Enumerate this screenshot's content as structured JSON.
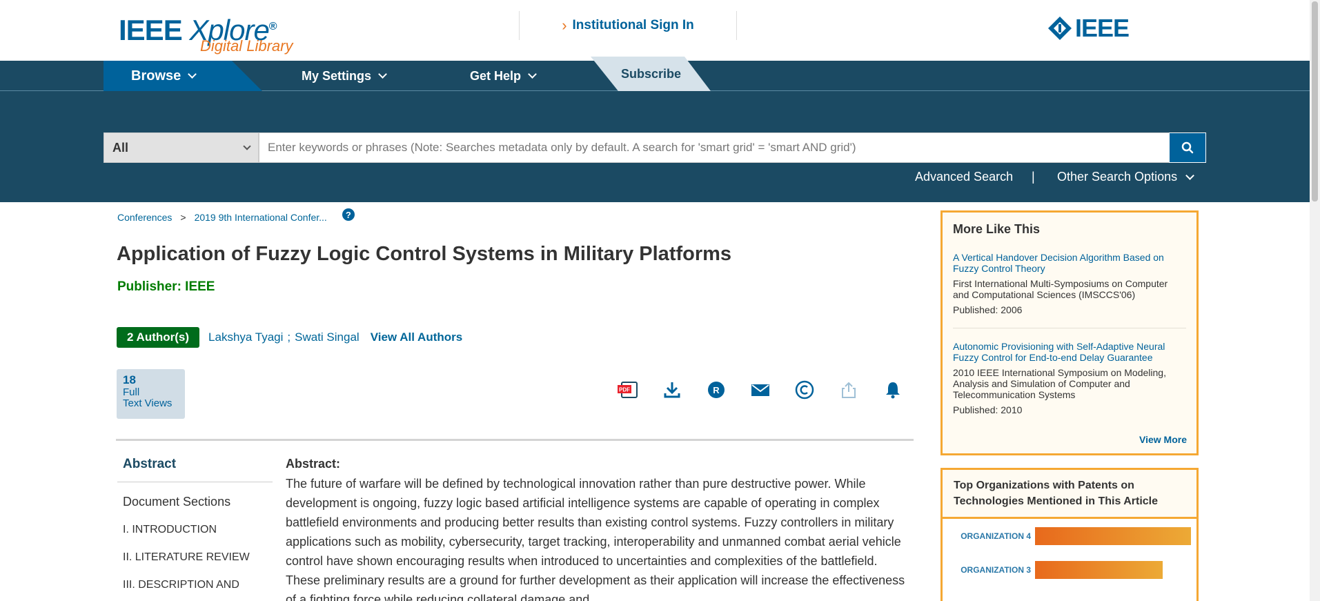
{
  "header": {
    "logo_main": "IEEE",
    "logo_xplore": "Xplore",
    "logo_reg": "®",
    "logo_sub": "Digital Library",
    "signin_label": "Institutional Sign In",
    "ieee_logo": "IEEE"
  },
  "nav": {
    "browse": "Browse",
    "my_settings": "My Settings",
    "get_help": "Get Help",
    "subscribe": "Subscribe"
  },
  "search": {
    "scope": "All",
    "placeholder": "Enter keywords or phrases (Note: Searches metadata only by default. A search for 'smart grid' = 'smart AND grid')",
    "advanced": "Advanced Search",
    "separator": "|",
    "other_options": "Other Search Options"
  },
  "breadcrumb": {
    "level1": "Conferences",
    "sep": ">",
    "level2": "2019 9th International Confer...",
    "help": "?"
  },
  "document": {
    "title": "Application of Fuzzy Logic Control Systems in Military Platforms",
    "publisher": "Publisher: IEEE",
    "author_count": "2 Author(s)",
    "authors": [
      "Lakshya Tyagi",
      "Swati Singal"
    ],
    "author_sep": ";",
    "view_all_authors": "View All Authors"
  },
  "metrics": {
    "count": "18",
    "label1": "Full",
    "label2": "Text Views"
  },
  "actions": [
    {
      "icon": "pdf-icon"
    },
    {
      "icon": "download-icon"
    },
    {
      "icon": "rights-icon"
    },
    {
      "icon": "email-icon"
    },
    {
      "icon": "copyright-icon"
    },
    {
      "icon": "share-icon"
    },
    {
      "icon": "alert-bell-icon"
    }
  ],
  "doc_nav": {
    "abstract": "Abstract",
    "sections_title": "Document Sections",
    "sections": [
      "I.   INTRODUCTION",
      "II.   LITERATURE REVIEW",
      "III.   DESCRIPTION AND"
    ]
  },
  "abstract": {
    "heading": "Abstract:",
    "text": "The future of warfare will be defined by technological innovation rather than pure destructive power. While development is ongoing, fuzzy logic based artificial intelligence systems are capable of operating in complex battlefield environments and producing better results than existing control systems. Fuzzy controllers in military applications such as mobility, cybersecurity, target tracking, interoperability and unmanned combat aerial vehicle control have shown encouraging results when introduced to uncertainties and complexities of the battlefield. These preliminary results are a ground for further development as their application will increase the effectiveness of a fighting force while reducing collateral damage and"
  },
  "more_like_this": {
    "title": "More Like This",
    "items": [
      {
        "title": "A Vertical Handover Decision Algorithm Based on Fuzzy Control Theory",
        "venue": "First International Multi-Symposiums on Computer and Computational Sciences (IMSCCS'06)",
        "published": "Published: 2006"
      },
      {
        "title": "Autonomic Provisioning with Self-Adaptive Neural Fuzzy Control for End-to-end Delay Guarantee",
        "venue": "2010 IEEE International Symposium on Modeling, Analysis and Simulation of Computer and Telecommunication Systems",
        "published": "Published: 2010"
      }
    ],
    "view_more": "View More"
  },
  "top_orgs": {
    "title": "Top Organizations with Patents on Technologies Mentioned in This Article",
    "orgs": [
      {
        "label": "ORGANIZATION 4",
        "value": 1.0
      },
      {
        "label": "ORGANIZATION 3",
        "value": 0.82
      }
    ]
  },
  "colors": {
    "brand_blue": "#00629b",
    "nav_dark": "#1b4a63",
    "accent_orange": "#e87722",
    "publisher_green": "#007c00",
    "sidebar_border": "#f5a833"
  }
}
